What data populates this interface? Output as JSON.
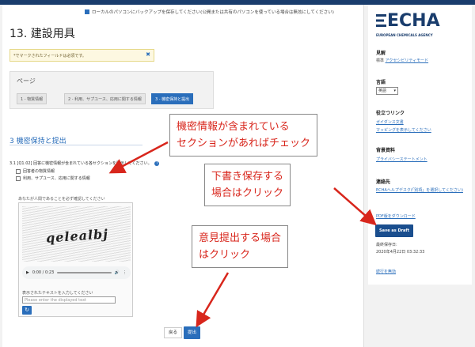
{
  "header": {
    "backup_text": "ローカルのパソコンにバックアップを保存してください(公開または共有のパソコンを使っている場合は無効にしてください)",
    "page_title": "13. 建設用具"
  },
  "alert": {
    "text": "*でマークされたフィールドは必須です。",
    "close": "✖"
  },
  "pages": {
    "label": "ページ",
    "steps": [
      "1 - 物質情報",
      "2 - 利用、サプユース、応用に関する情報",
      "3 - 機密保持と提出"
    ]
  },
  "section": {
    "title": "3 機密保持と提出",
    "question": "3.1 [Q1.02] 回答に機密情報が含まれている各セクションを明示してください。",
    "options": [
      "回答者の物質情報",
      "利用、サプユース、応用に関する情報"
    ]
  },
  "captcha": {
    "label": "あなたが人間であることを必ず確認してください",
    "image_text": "qelealbj",
    "audio_time": "0:00 / 0:23",
    "input_label": "表示されたテキストを入力してください",
    "input_placeholder": "Please enter the displayed text",
    "refresh": "↻"
  },
  "buttons": {
    "back": "戻る",
    "submit": "提出"
  },
  "sidebar": {
    "logo_text": "ECHA",
    "logo_sub": "EUROPEAN CHEMICALS AGENCY",
    "view_heading": "見解",
    "view_text": "標準",
    "view_link": "アクセシビリティモード",
    "lang_heading": "言語",
    "lang_value": "英語",
    "links_heading": "役立つリンク",
    "links": [
      "ガイダンス文書",
      "マッピングを表示してください"
    ],
    "background_heading": "背景資料",
    "background_link": "プライバシーステートメント",
    "contact_heading": "連絡先",
    "contact_link": "ECHAヘルプデスク(「別項」を選択してください)",
    "pdf_link": "PDF版をダウンロード",
    "draft_button": "Save as Draft",
    "last_saved_label": "最終保存日:",
    "last_saved_value": "2020年4月22日 03:32:33",
    "continue_link": "続行を無効"
  },
  "annotations": {
    "note1": [
      "機密情報が含まれている",
      "セクションがあればチェック"
    ],
    "note2": [
      "下書き保存する",
      "場合はクリック"
    ],
    "note3": [
      "意見提出する場合",
      "はクリック"
    ]
  },
  "colors": {
    "accent": "#2a6ebb",
    "annotation": "#d8261c",
    "brand": "#1a3d6d"
  }
}
